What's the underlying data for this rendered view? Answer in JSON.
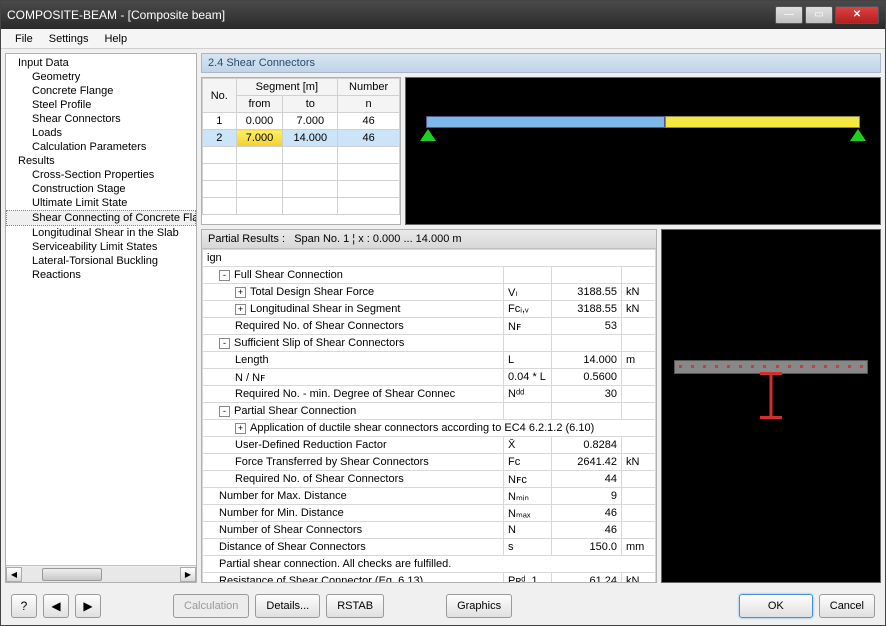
{
  "window": {
    "title": "COMPOSITE-BEAM - [Composite beam]"
  },
  "menu": [
    "File",
    "Settings",
    "Help"
  ],
  "tree": {
    "input": {
      "label": "Input Data",
      "children": [
        "Geometry",
        "Concrete Flange",
        "Steel Profile",
        "Shear Connectors",
        "Loads",
        "Calculation Parameters"
      ]
    },
    "results": {
      "label": "Results",
      "children": [
        "Cross-Section Properties",
        "Construction Stage",
        "Ultimate Limit State",
        "Shear Connecting of Concrete Flange",
        "Longitudinal Shear in the Slab",
        "Serviceability Limit States",
        "Lateral-Torsional Buckling",
        "Reactions"
      ]
    }
  },
  "section": {
    "title": "2.4 Shear Connectors"
  },
  "segtable": {
    "headers": {
      "no": "No.",
      "segment": "Segment [m]",
      "from": "from",
      "to": "to",
      "number": "Number",
      "n": "n"
    },
    "rows": [
      {
        "no": "1",
        "from": "0.000",
        "to": "7.000",
        "n": "46"
      },
      {
        "no": "2",
        "from": "7.000",
        "to": "14.000",
        "n": "46"
      }
    ]
  },
  "results": {
    "header_prefix": "Partial Results :",
    "header_span": "Span No. 1  ¦  x : 0.000 ... 14.000 m",
    "first_row_fragment": "ign",
    "rows": [
      {
        "indent": 0,
        "ctl": "-",
        "label": "Full Shear Connection",
        "sym": "",
        "val": "",
        "unit": ""
      },
      {
        "indent": 1,
        "ctl": "+",
        "label": "Total Design Shear Force",
        "sym": "Vₗ",
        "val": "3188.55",
        "unit": "kN"
      },
      {
        "indent": 1,
        "ctl": "+",
        "label": "Longitudinal Shear in Segment",
        "sym": "Fᴄᵢ,ᵥ",
        "val": "3188.55",
        "unit": "kN"
      },
      {
        "indent": 1,
        "ctl": "",
        "label": "Required No. of Shear Connectors",
        "sym": "Nꜰ",
        "val": "53",
        "unit": ""
      },
      {
        "indent": 0,
        "ctl": "-",
        "label": "Sufficient Slip of Shear Connectors",
        "sym": "",
        "val": "",
        "unit": ""
      },
      {
        "indent": 1,
        "ctl": "",
        "label": "Length",
        "sym": "L",
        "val": "14.000",
        "unit": "m"
      },
      {
        "indent": 1,
        "ctl": "",
        "label": "N / Nꜰ",
        "sym": "0.04 * L",
        "val": "0.5600",
        "unit": ""
      },
      {
        "indent": 1,
        "ctl": "",
        "label": "Required No. - min. Degree of Shear Connec",
        "sym": "Nᵈᵈ",
        "val": "30",
        "unit": ""
      },
      {
        "indent": 0,
        "ctl": "-",
        "label": "Partial Shear Connection",
        "sym": "",
        "val": "",
        "unit": ""
      },
      {
        "indent": 1,
        "ctl": "+",
        "label": "Application of ductile shear connectors according to EC4 6.2.1.2 (6.10)",
        "sym": "",
        "val": "",
        "unit": "",
        "span": true
      },
      {
        "indent": 1,
        "ctl": "",
        "label": "User-Defined Reduction Factor",
        "sym": "X̄",
        "val": "0.8284",
        "unit": ""
      },
      {
        "indent": 1,
        "ctl": "",
        "label": "Force Transferred by Shear Connectors",
        "sym": "Fᴄ",
        "val": "2641.42",
        "unit": "kN"
      },
      {
        "indent": 1,
        "ctl": "",
        "label": "Required No. of Shear Connectors",
        "sym": "Nꜰᴄ",
        "val": "44",
        "unit": ""
      },
      {
        "indent": 0,
        "ctl": "",
        "label": "Number for Max. Distance",
        "sym": "Nₘᵢₙ",
        "val": "9",
        "unit": ""
      },
      {
        "indent": 0,
        "ctl": "",
        "label": "Number for Min. Distance",
        "sym": "Nₘₐₓ",
        "val": "46",
        "unit": ""
      },
      {
        "indent": 0,
        "ctl": "",
        "label": "Number of Shear Connectors",
        "sym": "N",
        "val": "46",
        "unit": ""
      },
      {
        "indent": 0,
        "ctl": "",
        "label": "Distance of Shear Connectors",
        "sym": "s",
        "val": "150.0",
        "unit": "mm"
      },
      {
        "indent": 0,
        "ctl": "",
        "label": "Partial shear connection. All checks are fulfilled.",
        "sym": "",
        "val": "",
        "unit": "",
        "span": true
      },
      {
        "indent": 0,
        "ctl": "",
        "label": "Resistance of Shear Connector (Eq. 6.13)",
        "sym": "Pʀᵈ, 1",
        "val": "61.24",
        "unit": "kN"
      }
    ]
  },
  "footer": {
    "calculation": "Calculation",
    "details": "Details...",
    "rstab": "RSTAB",
    "graphics": "Graphics",
    "ok": "OK",
    "cancel": "Cancel"
  }
}
